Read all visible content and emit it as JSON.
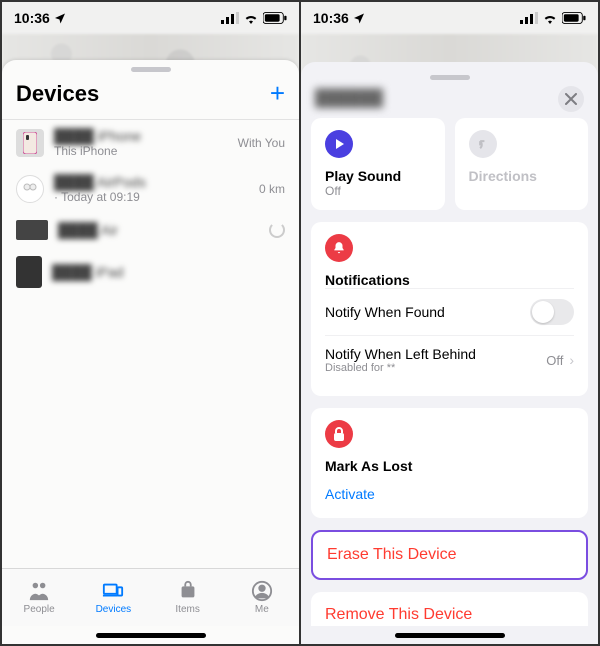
{
  "status": {
    "time": "10:36"
  },
  "left": {
    "title": "Devices",
    "devices": [
      {
        "name": "████ iPhone",
        "sub": "This iPhone",
        "meta": "With You"
      },
      {
        "name": "████ AirPods",
        "sub": "· Today at 09:19",
        "meta": "0 km"
      },
      {
        "name": "████ Air",
        "sub": "",
        "meta": ""
      },
      {
        "name": "████ iPad",
        "sub": "",
        "meta": ""
      }
    ],
    "tabs": {
      "people": "People",
      "devices": "Devices",
      "items": "Items",
      "me": "Me"
    }
  },
  "right": {
    "device_name": "██████",
    "play_sound": {
      "title": "Play Sound",
      "sub": "Off"
    },
    "directions": {
      "title": "Directions"
    },
    "notifications": {
      "heading": "Notifications",
      "notify_found": "Notify When Found",
      "notify_left": {
        "title": "Notify When Left Behind",
        "sub": "Disabled for **",
        "value": "Off"
      }
    },
    "mark_lost": {
      "heading": "Mark As Lost",
      "activate": "Activate"
    },
    "erase": "Erase This Device",
    "remove": "Remove This Device"
  }
}
